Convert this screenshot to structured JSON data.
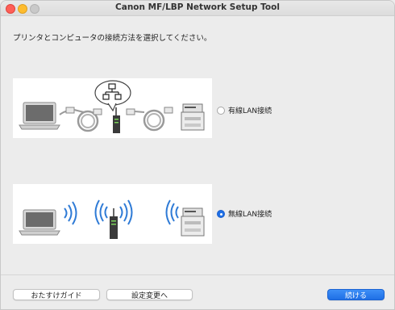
{
  "window": {
    "title": "Canon MF/LBP Network Setup Tool"
  },
  "instruction": "プリンタとコンピュータの接続方法を選択してください。",
  "options": {
    "wired": {
      "label": "有線LAN接続",
      "selected": false
    },
    "wireless": {
      "label": "無線LAN接続",
      "selected": true
    }
  },
  "buttons": {
    "guide": "おたすけガイド",
    "settings": "設定変更へ",
    "continue": "続ける"
  },
  "colors": {
    "accent": "#1f6fe5",
    "wireless_waves": "#2f7bd6"
  },
  "icons": [
    "laptop-icon",
    "cable-icon",
    "router-icon",
    "printer-icon",
    "network-icon",
    "wifi-waves-icon"
  ]
}
